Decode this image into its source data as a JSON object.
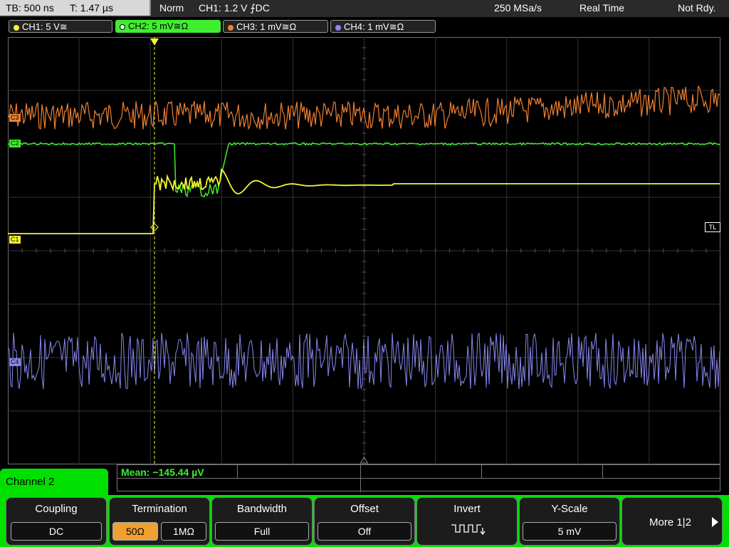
{
  "header": {
    "timebase": "TB: 500 ns",
    "trigger_time": "T: 1.47 µs",
    "mode": "Norm",
    "trigger_info": "CH1: 1.2 V ⨍DC",
    "sample_rate": "250 MSa/s",
    "acq_mode": "Real Time",
    "status": "Not Rdy."
  },
  "channels": [
    {
      "label": "CH1: 5 V≅",
      "color": "#f5f535"
    },
    {
      "label": "CH2: 5 mV≅Ω",
      "color": "#3fef2f"
    },
    {
      "label": "CH3: 1 mV≅Ω",
      "color": "#f08030"
    },
    {
      "label": "CH4: 1 mV≅Ω",
      "color": "#8888f0"
    }
  ],
  "markers": {
    "c3": "C3",
    "c2": "C2",
    "c1": "C1",
    "c4": "C4",
    "tl": "TL"
  },
  "measurement": {
    "mean": "Mean: −145.44 µV"
  },
  "menu": {
    "title": "Channel 2",
    "coupling_title": "Coupling",
    "coupling_value": "DC",
    "termination_title": "Termination",
    "termination_50": "50Ω",
    "termination_1m": "1MΩ",
    "bandwidth_title": "Bandwidth",
    "bandwidth_value": "Full",
    "offset_title": "Offset",
    "offset_value": "Off",
    "invert_title": "Invert",
    "yscale_title": "Y-Scale",
    "yscale_value": "5 mV",
    "more_label": "More 1|2"
  }
}
